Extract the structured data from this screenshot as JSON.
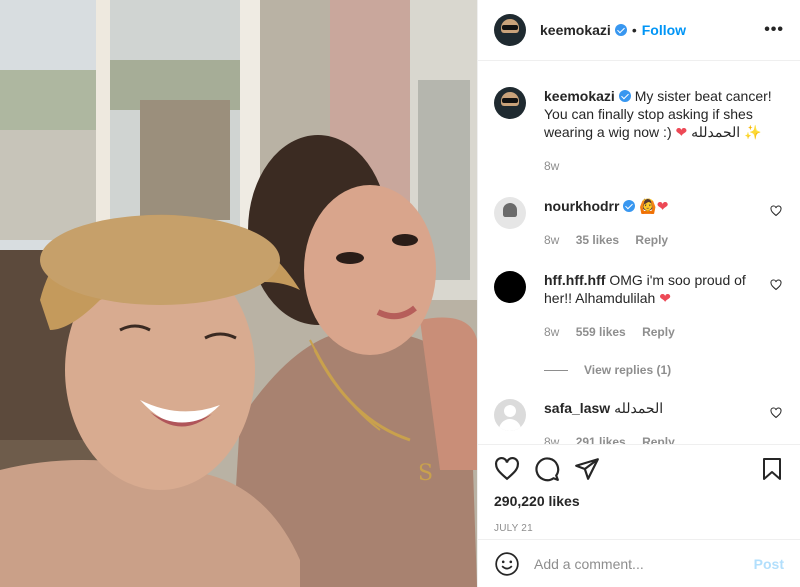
{
  "post": {
    "author": "keemokazi",
    "follow_label": "Follow",
    "dot": "•",
    "more": "•••"
  },
  "caption": {
    "username": "keemokazi",
    "text": "My sister beat cancer! You can finally stop asking if shes wearing a wig now :)",
    "heart": "❤",
    "arabic": "الحمدلله",
    "sparkle": "✨",
    "time": "8w"
  },
  "comments": [
    {
      "username": "nourkhodrr",
      "emoji1": "🙆",
      "heart": "❤",
      "time": "8w",
      "likes": "35 likes",
      "reply": "Reply"
    },
    {
      "username": "hff.hff.hff",
      "text": "OMG i'm soo proud of her!! Alhamdulilah",
      "heart": "❤",
      "time": "8w",
      "likes": "559 likes",
      "reply": "Reply",
      "view_replies": "View replies (1)"
    },
    {
      "username": "safa_lasw",
      "text": "الحمدلله",
      "time": "8w",
      "likes": "291 likes",
      "reply": "Reply"
    }
  ],
  "stats": {
    "likes": "290,220 likes",
    "date": "JULY 21"
  },
  "add_comment": {
    "placeholder": "Add a comment...",
    "post_label": "Post"
  },
  "colors": {
    "link_blue": "#0095f6",
    "verified": "#3897f0",
    "heart_red": "#ed4956"
  },
  "icons": [
    "verified-icon",
    "more-icon",
    "heart-icon",
    "comment-icon",
    "share-icon",
    "save-icon",
    "emoji-icon"
  ]
}
